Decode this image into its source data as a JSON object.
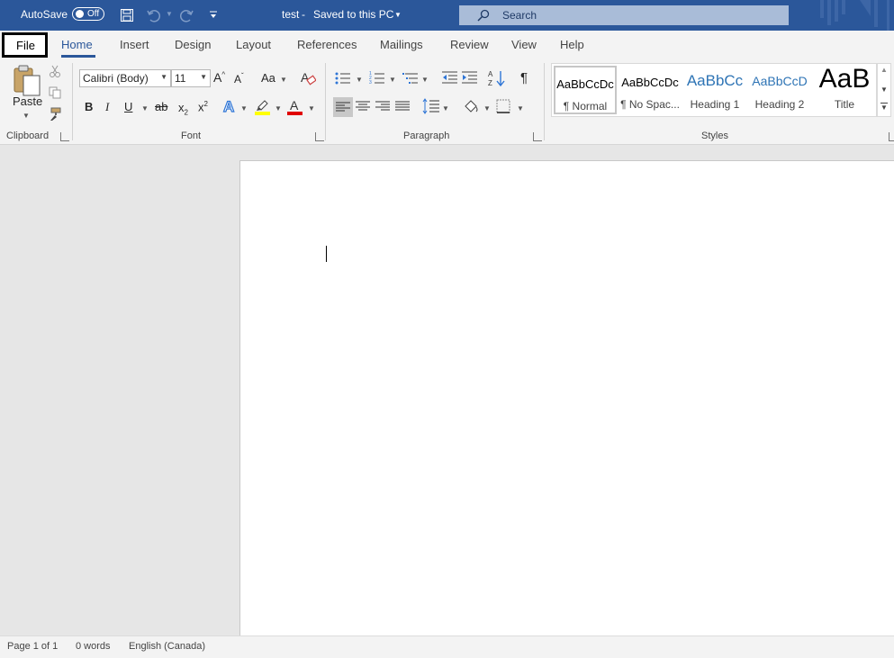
{
  "titlebar": {
    "autosave_label": "AutoSave",
    "autosave_state": "Off",
    "doc_title": "test",
    "save_status": "Saved to this PC",
    "search_placeholder": "Search"
  },
  "tabs": {
    "file": "File",
    "home": "Home",
    "insert": "Insert",
    "design": "Design",
    "layout": "Layout",
    "references": "References",
    "mailings": "Mailings",
    "review": "Review",
    "view": "View",
    "help": "Help"
  },
  "clipboard": {
    "paste": "Paste",
    "group": "Clipboard"
  },
  "font": {
    "family": "Calibri (Body)",
    "size": "11",
    "change_case": "Aa",
    "bold": "B",
    "italic": "I",
    "underline": "U",
    "strike": "ab",
    "subscript": "x",
    "superscript": "x",
    "group": "Font"
  },
  "paragraph": {
    "group": "Paragraph",
    "pilcrow": "¶"
  },
  "styles": {
    "group": "Styles",
    "items": [
      {
        "preview": "AaBbCcDc",
        "name": "¶ Normal"
      },
      {
        "preview": "AaBbCcDc",
        "name": "¶ No Spac..."
      },
      {
        "preview": "AaBbCc",
        "name": "Heading 1"
      },
      {
        "preview": "AaBbCcD",
        "name": "Heading 2"
      },
      {
        "preview": "AaB",
        "name": "Title"
      }
    ]
  },
  "status": {
    "page": "Page 1 of 1",
    "words": "0 words",
    "language": "English (Canada)"
  },
  "colors": {
    "brand": "#2b579a",
    "highlight": "#ffff00",
    "font_color": "#ff0000"
  }
}
